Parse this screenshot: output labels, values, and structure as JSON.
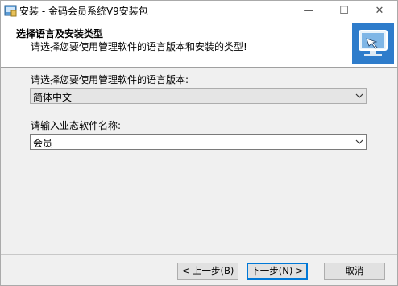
{
  "window": {
    "title": "安装 - 金码会员系统V9安装包",
    "minimize_glyph": "—",
    "maximize_glyph": "☐",
    "close_glyph": "✕"
  },
  "header": {
    "title": "选择语言及安装类型",
    "subtitle": "请选择您要使用管理软件的语言版本和安装的类型!",
    "image_icon": "computer-setup-icon"
  },
  "form": {
    "language_label": "请选择您要使用管理软件的语言版本:",
    "language_value": "简体中文",
    "company_label": "请输入业态软件名称:",
    "company_value": "会员"
  },
  "buttons": {
    "back": "< 上一步(B)",
    "next": "下一步(N) >",
    "cancel": "取消"
  },
  "colors": {
    "accent": "#0078d7",
    "header_image_bg": "#1e6fc0"
  }
}
